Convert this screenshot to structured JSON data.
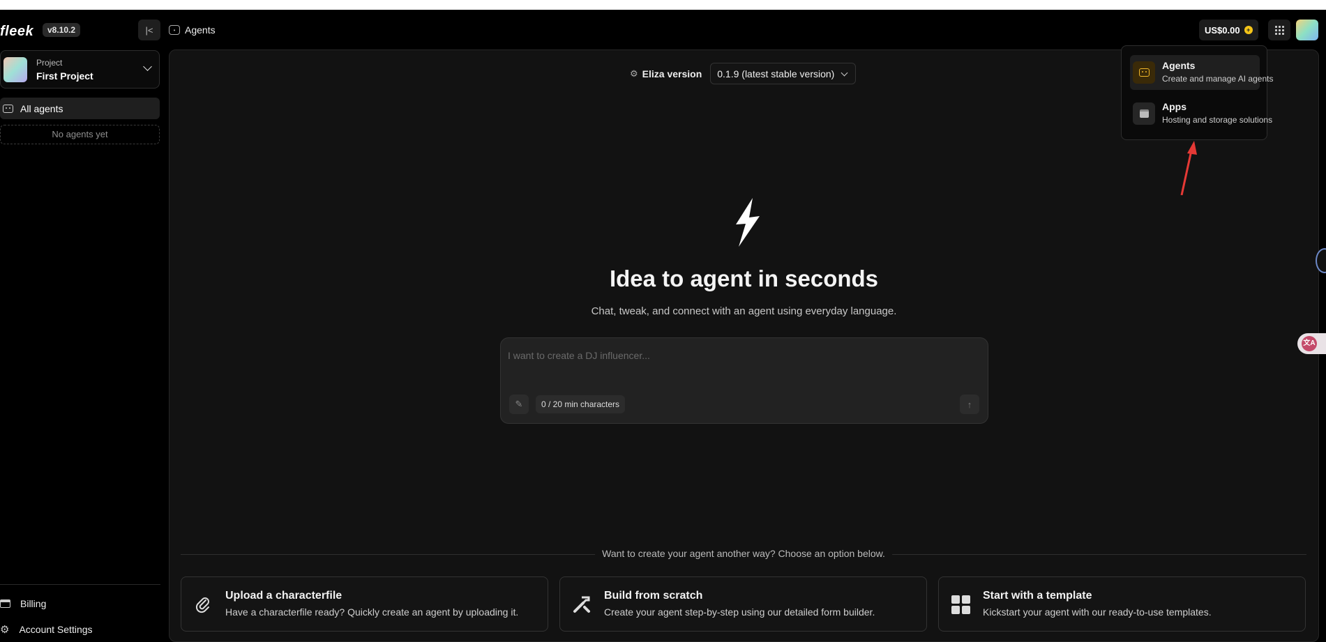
{
  "app": {
    "logo_text": "fleek",
    "version": "v8.10.2"
  },
  "breadcrumb": {
    "label": "Agents"
  },
  "header": {
    "balance": "US$0.00"
  },
  "sidebar": {
    "project_label": "Project",
    "project_name": "First Project",
    "nav_all_agents": "All agents",
    "empty_state": "No agents yet",
    "billing": "Billing",
    "account_settings": "Account Settings"
  },
  "eliza": {
    "label": "Eliza version",
    "selected": "0.1.9 (latest stable version)"
  },
  "hero": {
    "title": "Idea to agent in seconds",
    "subtitle": "Chat, tweak, and connect with an agent using everyday language."
  },
  "prompt": {
    "placeholder": "I want to create a DJ influencer...",
    "value": "",
    "char_count": "0 / 20 min characters"
  },
  "alternatives": {
    "divider_text": "Want to create your agent another way? Choose an option below.",
    "options": [
      {
        "title": "Upload a characterfile",
        "description": "Have a characterfile ready? Quickly create an agent by uploading it.",
        "icon": "paperclip-icon"
      },
      {
        "title": "Build from scratch",
        "description": "Create your agent step-by-step using our detailed form builder.",
        "icon": "tools-icon"
      },
      {
        "title": "Start with a template",
        "description": "Kickstart your agent with our ready-to-use templates.",
        "icon": "template-grid-icon"
      }
    ]
  },
  "apps_menu": {
    "items": [
      {
        "title": "Agents",
        "description": "Create and manage AI agents",
        "icon": "robot-icon",
        "active": true
      },
      {
        "title": "Apps",
        "description": "Hosting and storage solutions",
        "icon": "window-icon",
        "active": false
      }
    ]
  },
  "colors": {
    "accent": "#f1b72a",
    "background": "#000000",
    "panel": "#121212",
    "annotation": "#e53935"
  }
}
